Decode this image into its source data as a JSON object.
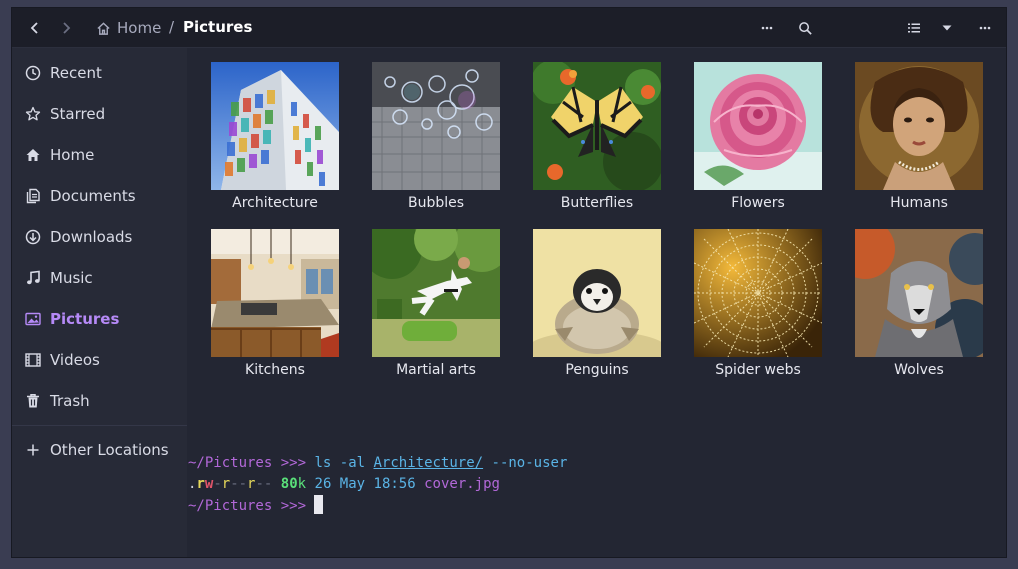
{
  "header": {
    "back_icon": "chevron-left-icon",
    "forward_icon": "chevron-right-icon",
    "breadcrumb_home": "Home",
    "breadcrumb_separator": "/",
    "breadcrumb_current": "Pictures"
  },
  "sidebar": {
    "items": [
      {
        "label": "Recent",
        "icon": "clock-icon"
      },
      {
        "label": "Starred",
        "icon": "star-icon"
      },
      {
        "label": "Home",
        "icon": "home-icon"
      },
      {
        "label": "Documents",
        "icon": "document-icon"
      },
      {
        "label": "Downloads",
        "icon": "download-icon"
      },
      {
        "label": "Music",
        "icon": "music-note-icon"
      },
      {
        "label": "Pictures",
        "icon": "image-icon"
      },
      {
        "label": "Videos",
        "icon": "film-icon"
      },
      {
        "label": "Trash",
        "icon": "trash-icon"
      }
    ],
    "other_locations": "Other Locations",
    "active_color": "#b68af7"
  },
  "folders": [
    {
      "label": "Architecture"
    },
    {
      "label": "Bubbles"
    },
    {
      "label": "Butterflies"
    },
    {
      "label": "Flowers"
    },
    {
      "label": "Humans"
    },
    {
      "label": "Kitchens"
    },
    {
      "label": "Martial arts"
    },
    {
      "label": "Penguins"
    },
    {
      "label": "Spider webs"
    },
    {
      "label": "Wolves"
    }
  ],
  "terminal": {
    "line1": {
      "path": "~/Pictures",
      "prompt": ">>>",
      "cmd": "ls",
      "flags": "-al",
      "arg": "Architecture/",
      "opt": "--no-user"
    },
    "line2": {
      "dot": ".",
      "perm_r1": "r",
      "perm_w1": "w",
      "perm_dash1": "-",
      "perm_r2": "r",
      "perm_dash2": "--",
      "perm_r3": "r",
      "perm_dash3": "--",
      "size": "80",
      "size_unit": "k",
      "date": "26 May 18:56",
      "file": "cover.jpg"
    },
    "line3": {
      "path": "~/Pictures",
      "prompt": ">>>"
    }
  }
}
